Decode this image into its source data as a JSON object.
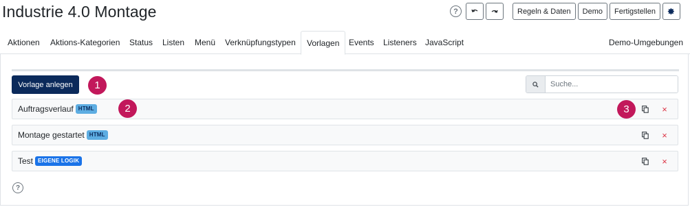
{
  "page": {
    "title": "Industrie 4.0 Montage"
  },
  "toolbar": {
    "help_glyph": "?",
    "undo_icon": "undo-icon",
    "redo_icon": "redo-icon",
    "rules_label": "Regeln & Daten",
    "demo_label": "Demo",
    "finish_label": "Fertigstellen",
    "settings_icon": "gear-icon"
  },
  "tabs": [
    {
      "label": "Aktionen"
    },
    {
      "label": "Aktions-Kategorien"
    },
    {
      "label": "Status"
    },
    {
      "label": "Listen"
    },
    {
      "label": "Menü"
    },
    {
      "label": "Verknüpfungstypen"
    },
    {
      "label": "Vorlagen",
      "active": true
    },
    {
      "label": "Events"
    },
    {
      "label": "Listeners"
    },
    {
      "label": "JavaScript"
    }
  ],
  "tabs_right": {
    "label": "Demo-Umgebungen"
  },
  "actions": {
    "create_label": "Vorlage anlegen"
  },
  "search": {
    "placeholder": "Suche...",
    "value": "",
    "icon": "search-icon"
  },
  "templates": [
    {
      "name": "Auftragsverlauf",
      "badge": "HTML",
      "badge_type": "html"
    },
    {
      "name": "Montage gestartet",
      "badge": "HTML",
      "badge_type": "html"
    },
    {
      "name": "Test",
      "badge": "EIGENE LOGIK",
      "badge_type": "logic"
    }
  ],
  "row_actions": {
    "copy_icon": "copy-icon",
    "delete_glyph": "×"
  },
  "markers": [
    "1",
    "2",
    "3"
  ],
  "footer": {
    "help_glyph": "?"
  },
  "colors": {
    "primary": "#0b2a5b",
    "marker": "#c2185b",
    "badge_html": "#5dade2",
    "badge_logic": "#1a73e8",
    "delete": "#dc3545"
  }
}
